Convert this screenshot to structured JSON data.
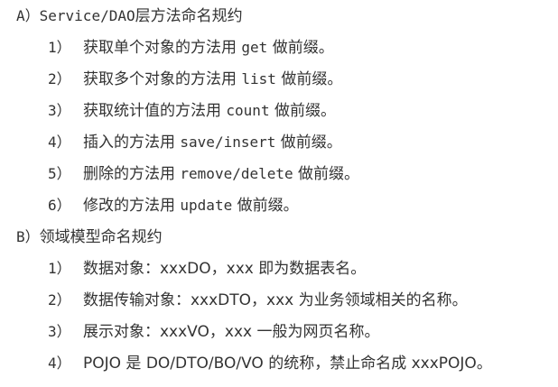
{
  "sections": [
    {
      "heading_prefix": "A）",
      "heading_code": "Service/DAO",
      "heading_text": "层方法命名规约",
      "items": [
        {
          "num": "1）",
          "pre": "获取单个对象的方法用",
          "code": "get",
          "post": "做前缀。"
        },
        {
          "num": "2）",
          "pre": "获取多个对象的方法用",
          "code": "list",
          "post": "做前缀。"
        },
        {
          "num": "3）",
          "pre": "获取统计值的方法用",
          "code": "count",
          "post": "做前缀。"
        },
        {
          "num": "4）",
          "pre": "插入的方法用",
          "code": "save/insert",
          "post": "做前缀。"
        },
        {
          "num": "5）",
          "pre": "删除的方法用",
          "code": "remove/delete",
          "post": "做前缀。"
        },
        {
          "num": "6）",
          "pre": "修改的方法用",
          "code": "update",
          "post": "做前缀。"
        }
      ]
    },
    {
      "heading_prefix": "B）",
      "heading_text": "领域模型命名规约",
      "items": [
        {
          "num": "1）",
          "text": "数据对象：xxxDO，xxx 即为数据表名。"
        },
        {
          "num": "2）",
          "text": "数据传输对象：xxxDTO，xxx 为业务领域相关的名称。"
        },
        {
          "num": "3）",
          "text": "展示对象：xxxVO，xxx 一般为网页名称。"
        },
        {
          "num": "4）",
          "text": "POJO 是 DO/DTO/BO/VO 的统称，禁止命名成 xxxPOJO。"
        }
      ]
    }
  ]
}
